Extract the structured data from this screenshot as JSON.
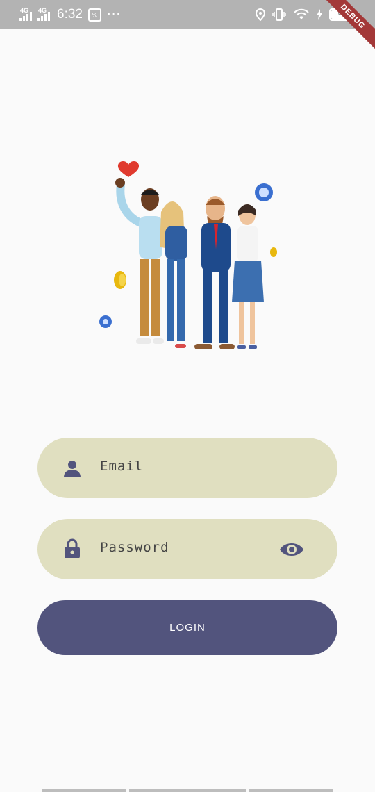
{
  "status_bar": {
    "network1": "4G",
    "network2": "4G",
    "time": "6:32",
    "vpn_label": "%",
    "more": "···",
    "battery": "92"
  },
  "debug_banner": "DEBUG",
  "illustration": "team-illustration",
  "form": {
    "email_placeholder": "Email",
    "password_placeholder": "Password",
    "login_label": "LOGIN"
  },
  "colors": {
    "background": "#fafafa",
    "field": "#e0dfc0",
    "accent": "#52547d",
    "status_bar": "#b3b3b3"
  }
}
